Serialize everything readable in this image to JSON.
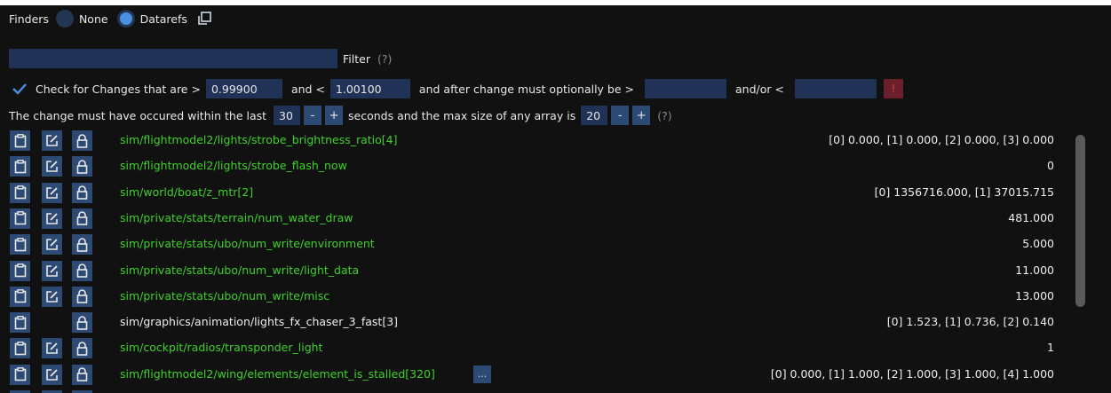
{
  "finders": {
    "label": "Finders",
    "options": [
      {
        "label": "None",
        "selected": false
      },
      {
        "label": "Datarefs",
        "selected": true
      }
    ]
  },
  "filter": {
    "value": "",
    "label": "Filter",
    "hint": "(?)"
  },
  "changes": {
    "check_label": "Check for Changes that are >",
    "min_value": "0.99900",
    "and_lt": "and <",
    "max_value": "1.00100",
    "after_label": "and after change must optionally be >",
    "after_value": "",
    "andor_label": "and/or <",
    "andor_value": "",
    "warn": "!"
  },
  "timing": {
    "prefix": "The change must have occured within the last",
    "seconds": "30",
    "minus": "-",
    "plus": "+",
    "mid": "seconds and the max size of any array is",
    "array_size": "20",
    "hint": "(?)"
  },
  "colors": {
    "green": "#3fd12b",
    "accent": "#4a8fe0",
    "button": "#2c4a73"
  },
  "rows": [
    {
      "path": "sim/flightmodel2/lights/strobe_brightness_ratio[4]",
      "value": "[0] 0.000, [1] 0.000, [2] 0.000, [3] 0.000",
      "writable": true,
      "more": false
    },
    {
      "path": "sim/flightmodel2/lights/strobe_flash_now",
      "value": "0",
      "writable": true,
      "more": false
    },
    {
      "path": "sim/world/boat/z_mtr[2]",
      "value": "[0] 1356716.000, [1] 37015.715",
      "writable": true,
      "more": false
    },
    {
      "path": "sim/private/stats/terrain/num_water_draw",
      "value": "481.000",
      "writable": true,
      "more": false
    },
    {
      "path": "sim/private/stats/ubo/num_write/environment",
      "value": "5.000",
      "writable": true,
      "more": false
    },
    {
      "path": "sim/private/stats/ubo/num_write/light_data",
      "value": "11.000",
      "writable": true,
      "more": false
    },
    {
      "path": "sim/private/stats/ubo/num_write/misc",
      "value": "13.000",
      "writable": true,
      "more": false
    },
    {
      "path": "sim/graphics/animation/lights_fx_chaser_3_fast[3]",
      "value": "[0] 1.523, [1] 0.736, [2] 0.140",
      "writable": false,
      "more": false
    },
    {
      "path": "sim/cockpit/radios/transponder_light",
      "value": "1",
      "writable": true,
      "more": false
    },
    {
      "path": "sim/flightmodel2/wing/elements/element_is_stalled[320]",
      "value": "[0] 0.000, [1] 1.000, [2] 1.000, [3] 1.000, [4] 1.000",
      "writable": true,
      "more": true,
      "more_label": "..."
    },
    {
      "path": "",
      "value": "",
      "writable": true,
      "more": false
    }
  ],
  "icons": [
    "clipboard-icon",
    "edit-icon",
    "lock-icon",
    "copy-window-icon",
    "checkmark-icon"
  ]
}
